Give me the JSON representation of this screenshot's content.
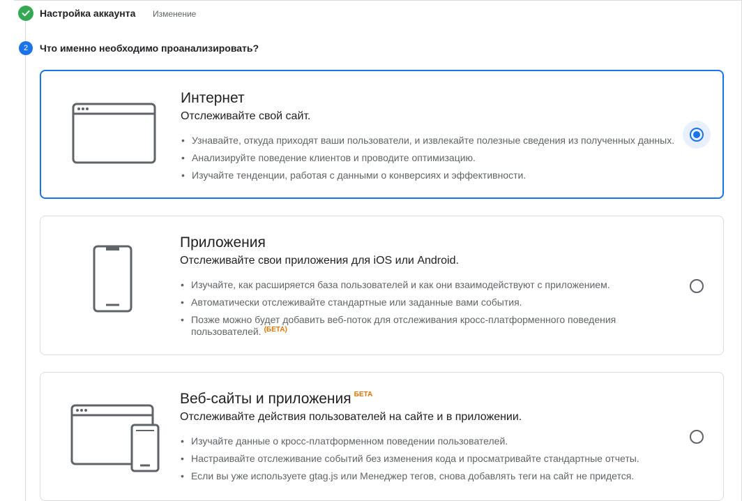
{
  "step1": {
    "title": "Настройка аккаунта",
    "edit_label": "Изменение",
    "status_icon": "check-icon",
    "status_color": "#34a853"
  },
  "step2": {
    "number": "2",
    "question": "Что именно необходимо проанализировать?",
    "accent_color": "#1a73e8"
  },
  "options": [
    {
      "title": "Интернет",
      "subtitle": "Отслеживайте свой сайт.",
      "icon": "browser-window-icon",
      "selected": true,
      "bullets": [
        "Узнавайте, откуда приходят ваши пользователи, и извлекайте полезные сведения из полученных данных.",
        "Анализируйте поведение клиентов и проводите оптимизацию.",
        "Изучайте тенденции, работая с данными о конверсиях и эффективности."
      ]
    },
    {
      "title": "Приложения",
      "subtitle": "Отслеживайте свои приложения для iOS или Android.",
      "icon": "smartphone-icon",
      "selected": false,
      "bullets": [
        "Изучайте, как расширяется база пользователей и как они взаимодействуют с приложением.",
        "Автоматически отслеживайте стандартные или заданные вами события.",
        "Позже можно будет добавить веб-поток для отслеживания кросс-платформенного поведения пользователей."
      ],
      "beta_label": "(БЕТА)"
    },
    {
      "title": "Веб-сайты и приложения",
      "title_badge": "БЕТА",
      "subtitle": "Отслеживайте действия пользователей на сайте и в приложении.",
      "icon": "browser-and-phone-icon",
      "selected": false,
      "bullets": [
        "Изучайте данные о кросс-платформенном поведении пользователей.",
        "Настраивайте отслеживание событий без изменения кода и просматривайте стандартные отчеты.",
        "Если вы уже используете gtag.js или Менеджер тегов, снова добавлять теги на сайт не придется."
      ]
    }
  ],
  "colors": {
    "beta": "#e37400",
    "border": "#dadce0",
    "text_secondary": "#5f6368"
  }
}
